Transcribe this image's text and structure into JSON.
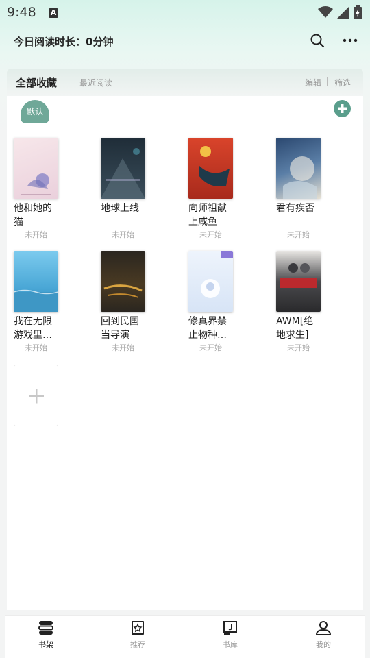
{
  "status_bar": {
    "time": "9:48",
    "notification_icon": "A"
  },
  "header": {
    "title": "今日阅读时长：0分钟",
    "search_icon": "search-icon",
    "more_icon": "more-icon"
  },
  "tabs": {
    "all_collections": "全部收藏",
    "recent_reading": "最近阅读",
    "edit": "编辑",
    "filter": "筛选"
  },
  "group": {
    "default_label": "默认"
  },
  "books": [
    {
      "title": "他和她的猫",
      "status": "未开始",
      "cover_color": "#f4dfe4"
    },
    {
      "title": "地球上线",
      "status": "未开始",
      "cover_color": "#2b3a45"
    },
    {
      "title": "向师祖献上咸鱼",
      "status": "未开始",
      "cover_color": "#c53a26"
    },
    {
      "title": "君有疾否",
      "status": "未开始",
      "cover_color": "#3d5d83"
    },
    {
      "title": "我在无限游戏里…",
      "status": "未开始",
      "cover_color": "#5fb8e3"
    },
    {
      "title": "回到民国当导演",
      "status": "未开始",
      "cover_color": "#2d2a24"
    },
    {
      "title": "修真界禁止物种…",
      "status": "未开始",
      "cover_color": "#e9f1fb"
    },
    {
      "title": "AWM[绝地求生]",
      "status": "未开始",
      "cover_color": "#3b3b3e"
    }
  ],
  "bottom_nav": [
    {
      "label": "书架",
      "icon": "bookshelf-icon",
      "active": true
    },
    {
      "label": "推荐",
      "icon": "recommend-icon",
      "active": false
    },
    {
      "label": "书库",
      "icon": "library-icon",
      "active": false
    },
    {
      "label": "我的",
      "icon": "profile-icon",
      "active": false
    }
  ]
}
